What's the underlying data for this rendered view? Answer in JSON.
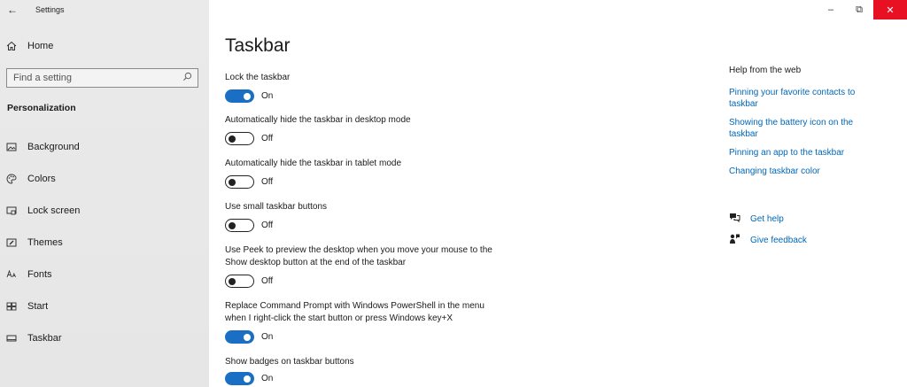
{
  "window": {
    "title": "Settings",
    "back_icon": "←",
    "minimize": "–",
    "restore": "⧉",
    "close": "✕"
  },
  "sidebar": {
    "home_label": "Home",
    "search_placeholder": "Find a setting",
    "section_title": "Personalization",
    "items": [
      {
        "label": "Background",
        "icon": "background-icon"
      },
      {
        "label": "Colors",
        "icon": "colors-icon"
      },
      {
        "label": "Lock screen",
        "icon": "lock-screen-icon"
      },
      {
        "label": "Themes",
        "icon": "themes-icon"
      },
      {
        "label": "Fonts",
        "icon": "fonts-icon"
      },
      {
        "label": "Start",
        "icon": "start-icon"
      },
      {
        "label": "Taskbar",
        "icon": "taskbar-icon"
      }
    ]
  },
  "main": {
    "title": "Taskbar",
    "settings": [
      {
        "label": "Lock the taskbar",
        "state": "On"
      },
      {
        "label": "Automatically hide the taskbar in desktop mode",
        "state": "Off"
      },
      {
        "label": "Automatically hide the taskbar in tablet mode",
        "state": "Off"
      },
      {
        "label": "Use small taskbar buttons",
        "state": "Off"
      },
      {
        "label_line1": "Use Peek to preview the desktop when you move your mouse to the",
        "label_line2": "Show desktop button at the end of the taskbar",
        "state": "Off"
      },
      {
        "label_line1": "Replace Command Prompt with Windows PowerShell in the menu",
        "label_line2": "when I right-click the start button or press Windows key+X",
        "state": "On"
      },
      {
        "label": "Show badges on taskbar buttons",
        "state": "On"
      }
    ]
  },
  "help": {
    "title": "Help from the web",
    "links": [
      {
        "line1": "Pinning your favorite contacts to",
        "line2": "taskbar"
      },
      {
        "line1": "Showing the battery icon on the",
        "line2": "taskbar"
      },
      {
        "line1": "Pinning an app to the taskbar",
        "line2": ""
      },
      {
        "line1": "Changing taskbar color",
        "line2": ""
      }
    ],
    "get_help": "Get help",
    "give_feedback": "Give feedback"
  },
  "colors": {
    "accent": "#1a6fc4",
    "link": "#0067b8",
    "close_bg": "#e81123",
    "sidebar_bg": "#e8e8e8"
  }
}
